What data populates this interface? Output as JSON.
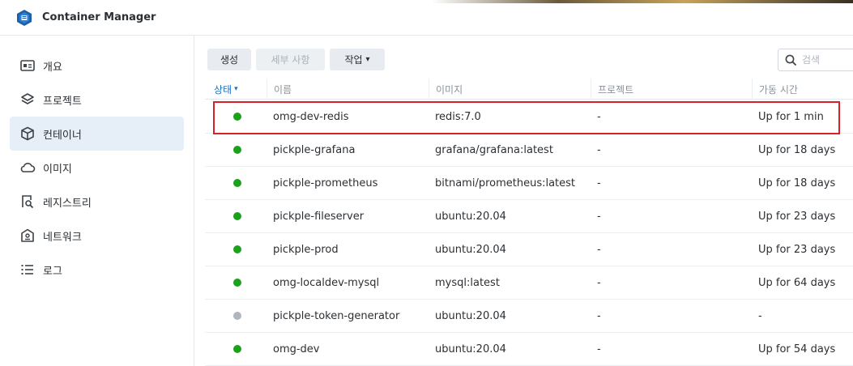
{
  "app": {
    "title": "Container Manager"
  },
  "sidebar": {
    "items": [
      {
        "label": "개요",
        "icon": "overview-icon",
        "active": false
      },
      {
        "label": "프로젝트",
        "icon": "layers-icon",
        "active": false
      },
      {
        "label": "컨테이너",
        "icon": "cube-icon",
        "active": true
      },
      {
        "label": "이미지",
        "icon": "cloud-icon",
        "active": false
      },
      {
        "label": "레지스트리",
        "icon": "registry-search-icon",
        "active": false
      },
      {
        "label": "네트워크",
        "icon": "network-icon",
        "active": false
      },
      {
        "label": "로그",
        "icon": "list-icon",
        "active": false
      }
    ]
  },
  "toolbar": {
    "create_label": "생성",
    "details_label": "세부 사항",
    "action_label": "작업",
    "action_caret": "▾",
    "search_placeholder": "검색"
  },
  "table": {
    "columns": [
      "상태",
      "이름",
      "이미지",
      "프로젝트",
      "가동 시간"
    ],
    "sort_indicator": "▾",
    "colors": {
      "running": "#1aa31a",
      "stopped": "#b0b6bd"
    },
    "rows": [
      {
        "status": "running",
        "name": "omg-dev-redis",
        "image": "redis:7.0",
        "project": "-",
        "uptime": "Up for 1 min"
      },
      {
        "status": "running",
        "name": "pickple-grafana",
        "image": "grafana/grafana:latest",
        "project": "-",
        "uptime": "Up for 18 days"
      },
      {
        "status": "running",
        "name": "pickple-prometheus",
        "image": "bitnami/prometheus:latest",
        "project": "-",
        "uptime": "Up for 18 days"
      },
      {
        "status": "running",
        "name": "pickple-fileserver",
        "image": "ubuntu:20.04",
        "project": "-",
        "uptime": "Up for 23 days"
      },
      {
        "status": "running",
        "name": "pickple-prod",
        "image": "ubuntu:20.04",
        "project": "-",
        "uptime": "Up for 23 days"
      },
      {
        "status": "running",
        "name": "omg-localdev-mysql",
        "image": "mysql:latest",
        "project": "-",
        "uptime": "Up for 64 days"
      },
      {
        "status": "stopped",
        "name": "pickple-token-generator",
        "image": "ubuntu:20.04",
        "project": "-",
        "uptime": "-"
      },
      {
        "status": "running",
        "name": "omg-dev",
        "image": "ubuntu:20.04",
        "project": "-",
        "uptime": "Up for 54 days"
      }
    ]
  }
}
